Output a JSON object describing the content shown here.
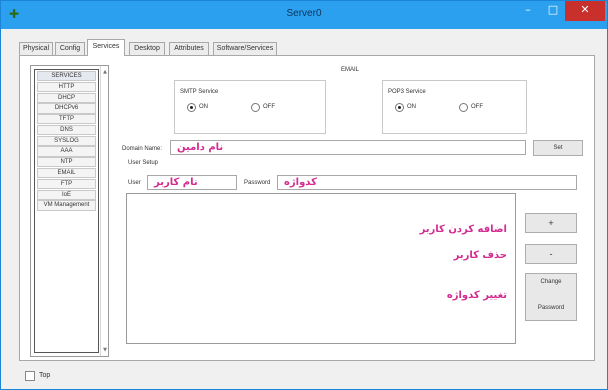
{
  "window": {
    "title": "Server0",
    "icons": {
      "app": "server-icon",
      "minimize": "minimize-icon",
      "maximize": "maximize-icon",
      "close": "close-icon"
    }
  },
  "tabs": [
    {
      "label": "Physical",
      "active": false
    },
    {
      "label": "Config",
      "active": false
    },
    {
      "label": "Services",
      "active": true
    },
    {
      "label": "Desktop",
      "active": false
    },
    {
      "label": "Attributes",
      "active": false
    },
    {
      "label": "Software/Services",
      "active": false
    }
  ],
  "services": {
    "header": "SERVICES",
    "items": [
      "HTTP",
      "DHCP",
      "DHCPv6",
      "TFTP",
      "DNS",
      "SYSLOG",
      "AAA",
      "NTP",
      "EMAIL",
      "FTP",
      "IoE",
      "VM Management"
    ]
  },
  "email": {
    "section_title": "EMAIL",
    "smtp": {
      "title": "SMTP Service",
      "on": "ON",
      "off": "OFF",
      "selected": "ON"
    },
    "pop3": {
      "title": "POP3 Service",
      "on": "ON",
      "off": "OFF",
      "selected": "ON"
    },
    "domain_label": "Domain Name:",
    "domain_value": "نام دامین",
    "set_button": "Set",
    "user_setup_label": "User Setup",
    "user_label": "User",
    "user_value": "نام کاربر",
    "password_label": "Password",
    "password_value": "کدواژه",
    "add_button": "+",
    "remove_button": "-",
    "change_button_line1": "Change",
    "change_button_line2": "Password",
    "annotations": {
      "add_user": "اضافه کردن کاربر",
      "remove_user": "حذف کاربر",
      "change_password": "تغییر کدواژه"
    }
  },
  "footer": {
    "top_label": "Top",
    "top_checked": false
  },
  "colors": {
    "titlebar": "#2aa0ef",
    "close": "#c9302c",
    "annotation": "#d32b8f"
  }
}
